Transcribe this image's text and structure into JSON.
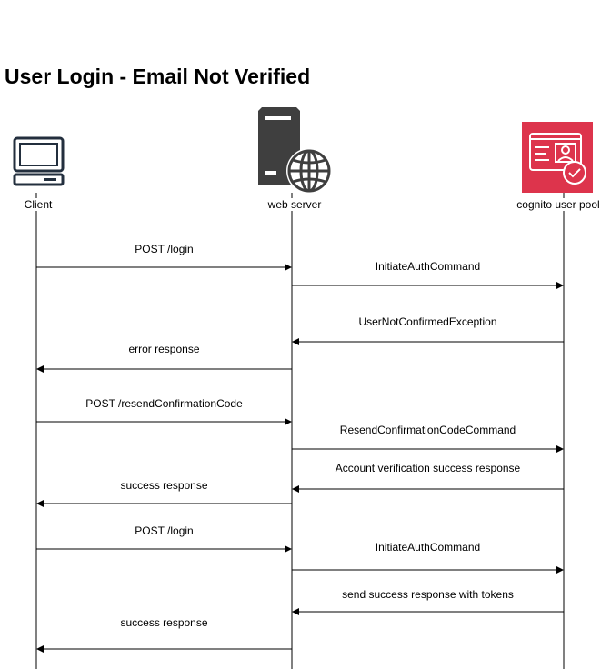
{
  "title": "User Login - Email Not Verified",
  "actors": [
    {
      "id": "client",
      "label": "Client",
      "icon": "computer-monitor-icon"
    },
    {
      "id": "server",
      "label": "web server",
      "icon": "server-globe-icon"
    },
    {
      "id": "cognito",
      "label": "cognito user pool",
      "icon": "cognito-user-pool-icon"
    }
  ],
  "colors": {
    "client_icon": "#232f3e",
    "server_icon": "#3f3f3f",
    "cognito_bg": "#dd344c",
    "line": "#000000"
  },
  "messages": [
    {
      "from": "client",
      "to": "server",
      "label": "POST /login"
    },
    {
      "from": "server",
      "to": "cognito",
      "label": "InitiateAuthCommand"
    },
    {
      "from": "cognito",
      "to": "server",
      "label": "UserNotConfirmedException"
    },
    {
      "from": "server",
      "to": "client",
      "label": "error response"
    },
    {
      "from": "client",
      "to": "server",
      "label": "POST /resendConfirmationCode"
    },
    {
      "from": "server",
      "to": "cognito",
      "label": "ResendConfirmationCodeCommand"
    },
    {
      "from": "cognito",
      "to": "server",
      "label": "Account verification success response"
    },
    {
      "from": "server",
      "to": "client",
      "label": "success response"
    },
    {
      "from": "client",
      "to": "server",
      "label": "POST /login"
    },
    {
      "from": "server",
      "to": "cognito",
      "label": "InitiateAuthCommand"
    },
    {
      "from": "cognito",
      "to": "server",
      "label": "send success response with tokens"
    },
    {
      "from": "server",
      "to": "client",
      "label": "success response"
    }
  ]
}
